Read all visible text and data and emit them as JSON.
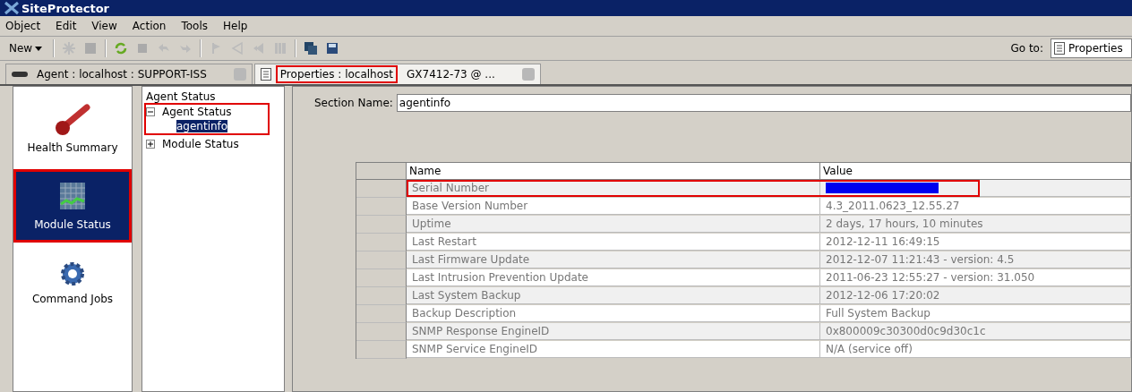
{
  "window": {
    "title": "SiteProtector"
  },
  "menu": [
    "Object",
    "Edit",
    "View",
    "Action",
    "Tools",
    "Help"
  ],
  "toolbar": {
    "new_label": "New",
    "goto_label": "Go to:",
    "goto_value": "Properties"
  },
  "tabs": [
    {
      "label": "Agent : localhost : SUPPORT-ISS",
      "selected": false,
      "highlighted": false,
      "kind": "agent"
    },
    {
      "label": "Properties : localhost",
      "detail": "GX7412-73 @ ...",
      "selected": true,
      "highlighted": true,
      "kind": "properties"
    }
  ],
  "nav": [
    {
      "label": "Health Summary",
      "kind": "thermometer",
      "selected": false,
      "highlighted": false
    },
    {
      "label": "Module Status",
      "kind": "grid",
      "selected": true,
      "highlighted": true
    },
    {
      "label": "Command Jobs",
      "kind": "gear",
      "selected": false,
      "highlighted": false
    }
  ],
  "tree": {
    "title": "Agent Status",
    "items": [
      {
        "label": "Agent Status",
        "expanded": true,
        "selected": false,
        "highlighted": true,
        "children": [
          {
            "label": "agentinfo",
            "selected": true
          }
        ]
      },
      {
        "label": "Module Status",
        "expanded": false,
        "selected": false,
        "highlighted": false
      }
    ]
  },
  "section": {
    "label": "Section Name:",
    "value": "agentinfo"
  },
  "table": {
    "columns": [
      "Name",
      "Value"
    ],
    "rows": [
      {
        "name": "Serial Number",
        "redacted": true,
        "highlighted": true
      },
      {
        "name": "Base Version Number",
        "value": "4.3_2011.0623_12.55.27",
        "redacted": false,
        "highlighted": false
      },
      {
        "name": "Uptime",
        "value": "2 days, 17 hours, 10 minutes",
        "redacted": false,
        "highlighted": false
      },
      {
        "name": "Last Restart",
        "value": "2012-12-11 16:49:15",
        "redacted": false,
        "highlighted": false
      },
      {
        "name": "Last Firmware Update",
        "value": "2012-12-07 11:21:43 - version: 4.5",
        "redacted": false,
        "highlighted": false
      },
      {
        "name": "Last Intrusion Prevention Update",
        "value": "2011-06-23 12:55:27 - version: 31.050",
        "redacted": false,
        "highlighted": false
      },
      {
        "name": "Last System Backup",
        "value": "2012-12-06 17:20:02",
        "redacted": false,
        "highlighted": false
      },
      {
        "name": "Backup Description",
        "value": "Full System Backup",
        "redacted": false,
        "highlighted": false
      },
      {
        "name": "SNMP Response EngineID",
        "value": "0x800009c30300d0c9d30c1c",
        "redacted": false,
        "highlighted": false
      },
      {
        "name": "SNMP Service EngineID",
        "value": "N/A (service off)",
        "redacted": false,
        "highlighted": false
      }
    ]
  }
}
